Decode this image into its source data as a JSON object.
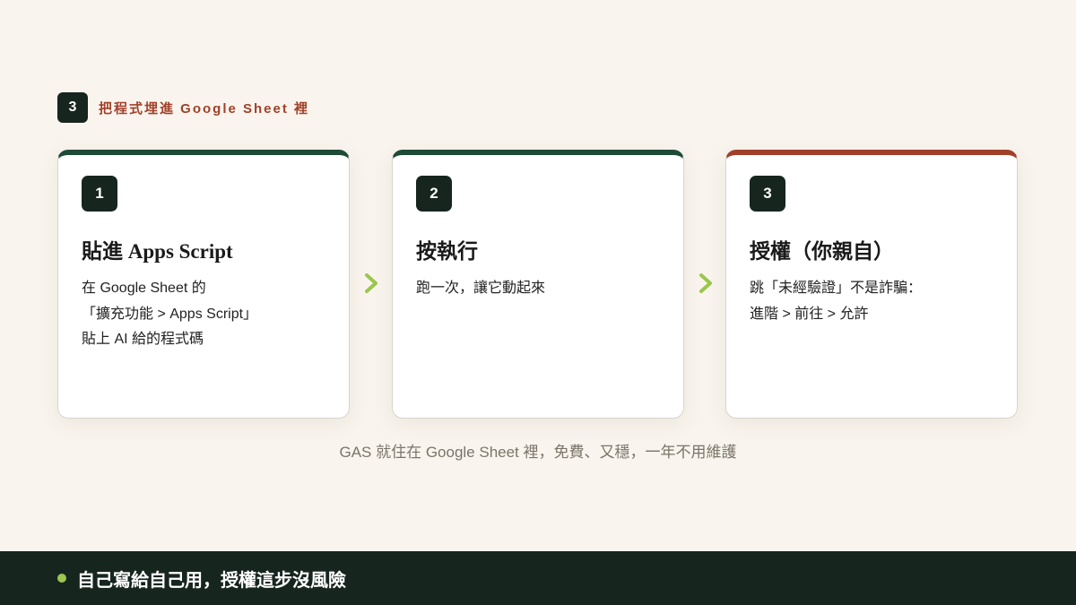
{
  "section": {
    "number": "3",
    "title": "把程式埋進 Google Sheet 裡"
  },
  "steps": [
    {
      "number": "1",
      "title": "貼進 Apps Script",
      "lines": [
        "在 Google Sheet 的",
        "「擴充功能 > Apps Script」",
        "貼上 AI 給的程式碼"
      ]
    },
    {
      "number": "2",
      "title": "按執行",
      "lines": [
        "跑一次，讓它動起來"
      ]
    },
    {
      "number": "3",
      "title": "授權（你親自）",
      "lines": [
        "跳「未經驗證」不是詐騙：",
        "進階 > 前往 > 允許"
      ]
    }
  ],
  "caption": "GAS 就住在 Google Sheet 裡，免費、又穩，一年不用維護",
  "footer": {
    "text": "自己寫給自己用，授權這步沒風險"
  },
  "colors": {
    "background": "#f9f5ee",
    "dark": "#17251f",
    "green_accent": "#1e4a38",
    "red_accent": "#a1402a",
    "arrow": "#9cc64f"
  },
  "icons": {
    "arrow": "chevron-right-icon",
    "bullet": "dot-icon"
  }
}
